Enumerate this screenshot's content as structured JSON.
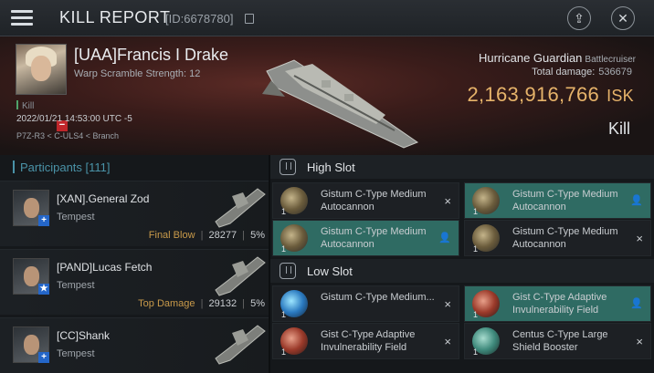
{
  "titlebar": {
    "title": "KILL REPORT",
    "report_id": "[ID:6678780]",
    "menu_icon": "hamburger-menu-icon",
    "share_icon": "external-link-icon",
    "close_icon": "close-icon",
    "share_glyph": "⇪",
    "close_glyph": "✕"
  },
  "victim": {
    "name": "[UAA]Francis I Drake",
    "warp_scramble": "Warp Scramble Strength: 12",
    "tag": "Kill",
    "timestamp": "2022/01/21 14:53:00 UTC -5",
    "location": "P7Z-R3 < C-ULS4 < Branch",
    "ship_name": "Hurricane Guardian",
    "ship_class": "Battlecruiser",
    "total_damage_label": "Total damage:",
    "total_damage": "536679",
    "isk_value": "2,163,916,766",
    "isk_unit": "ISK",
    "result": "Kill",
    "badge_glyph": "−"
  },
  "participants": {
    "header": "Participants [111]",
    "rows": [
      {
        "name": "[XAN].General Zod",
        "ship": "Tempest",
        "role": "Final Blow",
        "damage": "28277",
        "percent": "5%",
        "badge": "+"
      },
      {
        "name": "[PAND]Lucas Fetch",
        "ship": "Tempest",
        "role": "Top Damage",
        "damage": "29132",
        "percent": "5%",
        "badge": "★"
      },
      {
        "name": "[CC]Shank",
        "ship": "Tempest",
        "role": "",
        "damage": "",
        "percent": "",
        "badge": "+"
      }
    ],
    "separator": "|"
  },
  "slots": {
    "high": {
      "title": "High Slot",
      "items": [
        {
          "name": "Gistum C-Type Medium Autocannon",
          "qty": "1",
          "action": "×",
          "highlighted": false
        },
        {
          "name": "Gistum C-Type Medium Autocannon",
          "qty": "1",
          "action": "👤",
          "highlighted": true
        },
        {
          "name": "Gistum C-Type Medium Autocannon",
          "qty": "1",
          "action": "👤",
          "highlighted": true
        },
        {
          "name": "Gistum C-Type Medium Autocannon",
          "qty": "1",
          "action": "×",
          "highlighted": false
        }
      ]
    },
    "low": {
      "title": "Low Slot",
      "items": [
        {
          "name": "Gistum C-Type Medium...",
          "qty": "1",
          "action": "×",
          "highlighted": false
        },
        {
          "name": "Gist C-Type Adaptive Invulnerability Field",
          "qty": "1",
          "action": "👤",
          "highlighted": true
        },
        {
          "name": "Gist C-Type Adaptive Invulnerability Field",
          "qty": "1",
          "action": "×",
          "highlighted": false
        },
        {
          "name": "Centus C-Type Large Shield Booster",
          "qty": "1",
          "action": "×",
          "highlighted": false
        }
      ]
    }
  },
  "colors": {
    "isk": "#e6b36a",
    "participants_accent": "#4a93a8",
    "highlight": "#2f6b63",
    "role": "#c99a4a"
  }
}
